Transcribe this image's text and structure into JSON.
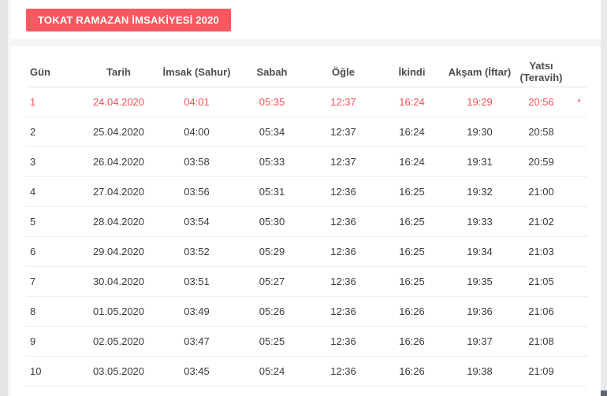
{
  "page": {
    "title_button": "TOKAT RAMAZAN İMSAKİYESİ 2020",
    "accent_color": "#f8585f",
    "highlight_color": "#f2505a",
    "footnote_marker": "*"
  },
  "table": {
    "columns": [
      "Gün",
      "Tarih",
      "İmsak (Sahur)",
      "Sabah",
      "Öğle",
      "İkindi",
      "Akşam (İftar)",
      "Yatsı (Teravih)"
    ],
    "note_column_label": "",
    "rows": [
      {
        "highlight": true,
        "cells": [
          "1",
          "24.04.2020",
          "04:01",
          "05:35",
          "12:37",
          "16:24",
          "19:29",
          "20:56",
          "*"
        ]
      },
      {
        "highlight": false,
        "cells": [
          "2",
          "25.04.2020",
          "04:00",
          "05:34",
          "12:37",
          "16:24",
          "19:30",
          "20:58",
          ""
        ]
      },
      {
        "highlight": false,
        "cells": [
          "3",
          "26.04.2020",
          "03:58",
          "05:33",
          "12:37",
          "16:24",
          "19:31",
          "20:59",
          ""
        ]
      },
      {
        "highlight": false,
        "cells": [
          "4",
          "27.04.2020",
          "03:56",
          "05:31",
          "12:36",
          "16:25",
          "19:32",
          "21:00",
          ""
        ]
      },
      {
        "highlight": false,
        "cells": [
          "5",
          "28.04.2020",
          "03:54",
          "05:30",
          "12:36",
          "16:25",
          "19:33",
          "21:02",
          ""
        ]
      },
      {
        "highlight": false,
        "cells": [
          "6",
          "29.04.2020",
          "03:52",
          "05:29",
          "12:36",
          "16:25",
          "19:34",
          "21:03",
          ""
        ]
      },
      {
        "highlight": false,
        "cells": [
          "7",
          "30.04.2020",
          "03:51",
          "05:27",
          "12:36",
          "16:25",
          "19:35",
          "21:05",
          ""
        ]
      },
      {
        "highlight": false,
        "cells": [
          "8",
          "01.05.2020",
          "03:49",
          "05:26",
          "12:36",
          "16:26",
          "19:36",
          "21:06",
          ""
        ]
      },
      {
        "highlight": false,
        "cells": [
          "9",
          "02.05.2020",
          "03:47",
          "05:25",
          "12:36",
          "16:26",
          "19:37",
          "21:08",
          ""
        ]
      },
      {
        "highlight": false,
        "cells": [
          "10",
          "03.05.2020",
          "03:45",
          "05:24",
          "12:36",
          "16:26",
          "19:38",
          "21:09",
          ""
        ]
      }
    ]
  }
}
